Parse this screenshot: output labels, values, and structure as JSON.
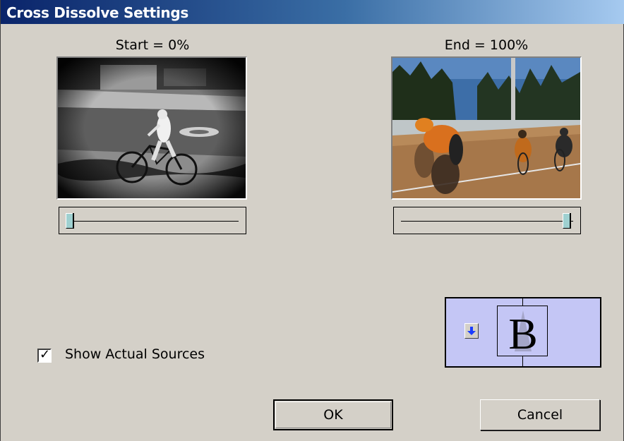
{
  "window": {
    "title": "Cross Dissolve Settings"
  },
  "start": {
    "label": "Start = 0%",
    "value_percent": 0,
    "image": "black-and-white cyclist on a bicycle"
  },
  "end": {
    "label": "End = 100%",
    "value_percent": 100,
    "image": "color track cyclists racing"
  },
  "options": {
    "show_actual_sources_label": "Show Actual Sources",
    "show_actual_sources_checked": true,
    "check_glyph": "✓"
  },
  "direction": {
    "letter": "B",
    "arrow_icon": "down-arrow-icon"
  },
  "buttons": {
    "ok": "OK",
    "cancel": "Cancel"
  },
  "colors": {
    "title_start": "#0a246a",
    "title_end": "#a6caf0",
    "dialog_bg": "#d4d0c8",
    "direction_bg": "#c4c6f5",
    "slider_thumb": "#9fd0d0",
    "arrow": "#1a3cff"
  }
}
